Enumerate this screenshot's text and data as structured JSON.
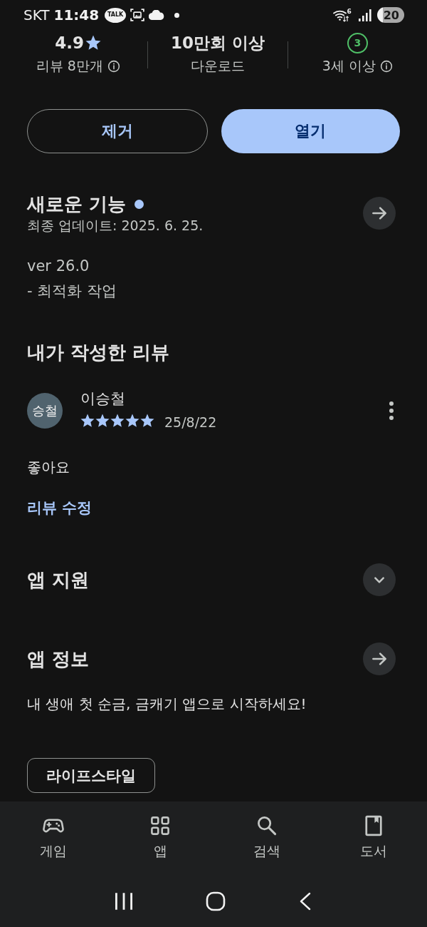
{
  "status_bar": {
    "carrier": "SKT",
    "time": "11:48",
    "chat_badge": "TALK",
    "wifi_label": "6",
    "battery": "20"
  },
  "stats": [
    {
      "kind": "rating",
      "value": "4.9",
      "label": "리뷰 8만개",
      "info": true
    },
    {
      "kind": "text",
      "value": "10만회 이상",
      "label": "다운로드",
      "info": false
    },
    {
      "kind": "age",
      "value": "3",
      "label": "3세 이상",
      "info": true
    }
  ],
  "actions": [
    {
      "kind": "outlined",
      "label": "제거"
    },
    {
      "kind": "filled",
      "label": "열기"
    }
  ],
  "whats_new": {
    "title": "새로운 기능",
    "unread": true,
    "updated": "최종 업데이트: 2025. 6. 25.",
    "notes": [
      "ver 26.0",
      "- 최적화 작업"
    ]
  },
  "my_review": {
    "title": "내가 작성한 리뷰",
    "avatar": "승철",
    "author": "이승철",
    "stars": 5,
    "date": "25/8/22",
    "text": "좋아요",
    "edit_link": "리뷰 수정"
  },
  "app_support": {
    "title": "앱 지원",
    "expanded": false
  },
  "app_info": {
    "title": "앱 정보",
    "description": "내 생애 첫 순금, 금캐기 앱으로 시작하세요!",
    "tags": [
      "라이프스타일"
    ]
  },
  "bottom_nav": [
    {
      "kind": "games",
      "label": "게임",
      "selected": false
    },
    {
      "kind": "apps",
      "label": "앱",
      "selected": false
    },
    {
      "kind": "search",
      "label": "검색",
      "selected": false
    },
    {
      "kind": "books",
      "label": "도서",
      "selected": false
    }
  ]
}
